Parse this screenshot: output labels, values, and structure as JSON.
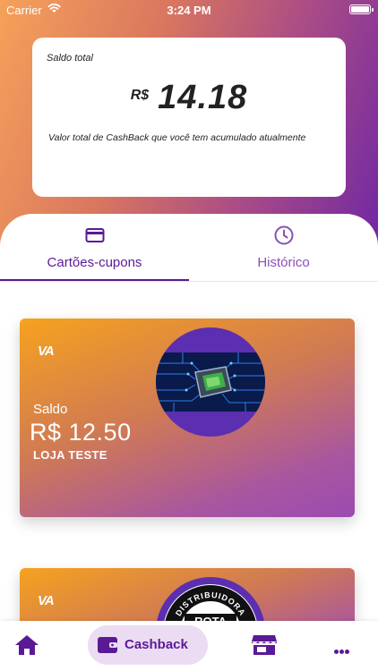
{
  "status_bar": {
    "carrier": "Carrier",
    "time": "3:24 PM",
    "battery_level": 1.0
  },
  "balance": {
    "label": "Saldo total",
    "currency": "R$",
    "amount": "14.18",
    "description": "Valor total de CashBack que você tem acumulado atualmente"
  },
  "tabs": [
    {
      "label": "Cartões-cupons",
      "icon": "credit-card-icon",
      "active": true
    },
    {
      "label": "Histórico",
      "icon": "clock-icon",
      "active": false
    }
  ],
  "coupons": [
    {
      "logo": "VA",
      "saldo_label": "Saldo",
      "saldo_value": "R$ 12.50",
      "store_name": "LOJA TESTE",
      "image": "circuit-chip-image"
    },
    {
      "logo": "VA",
      "image": "distribuidora-rota-logo",
      "image_text": [
        "DISTRIBUIDORA",
        "ROTA"
      ]
    }
  ],
  "bottom_nav": {
    "home_icon": "home-icon",
    "cashback_label": "Cashback",
    "cashback_icon": "wallet-icon",
    "store_icon": "store-icon",
    "more_icon": "more-icon"
  },
  "colors": {
    "accent": "#5a1a96",
    "accent_light": "#8a4fb8",
    "nav_pill": "#ecdcf3"
  }
}
